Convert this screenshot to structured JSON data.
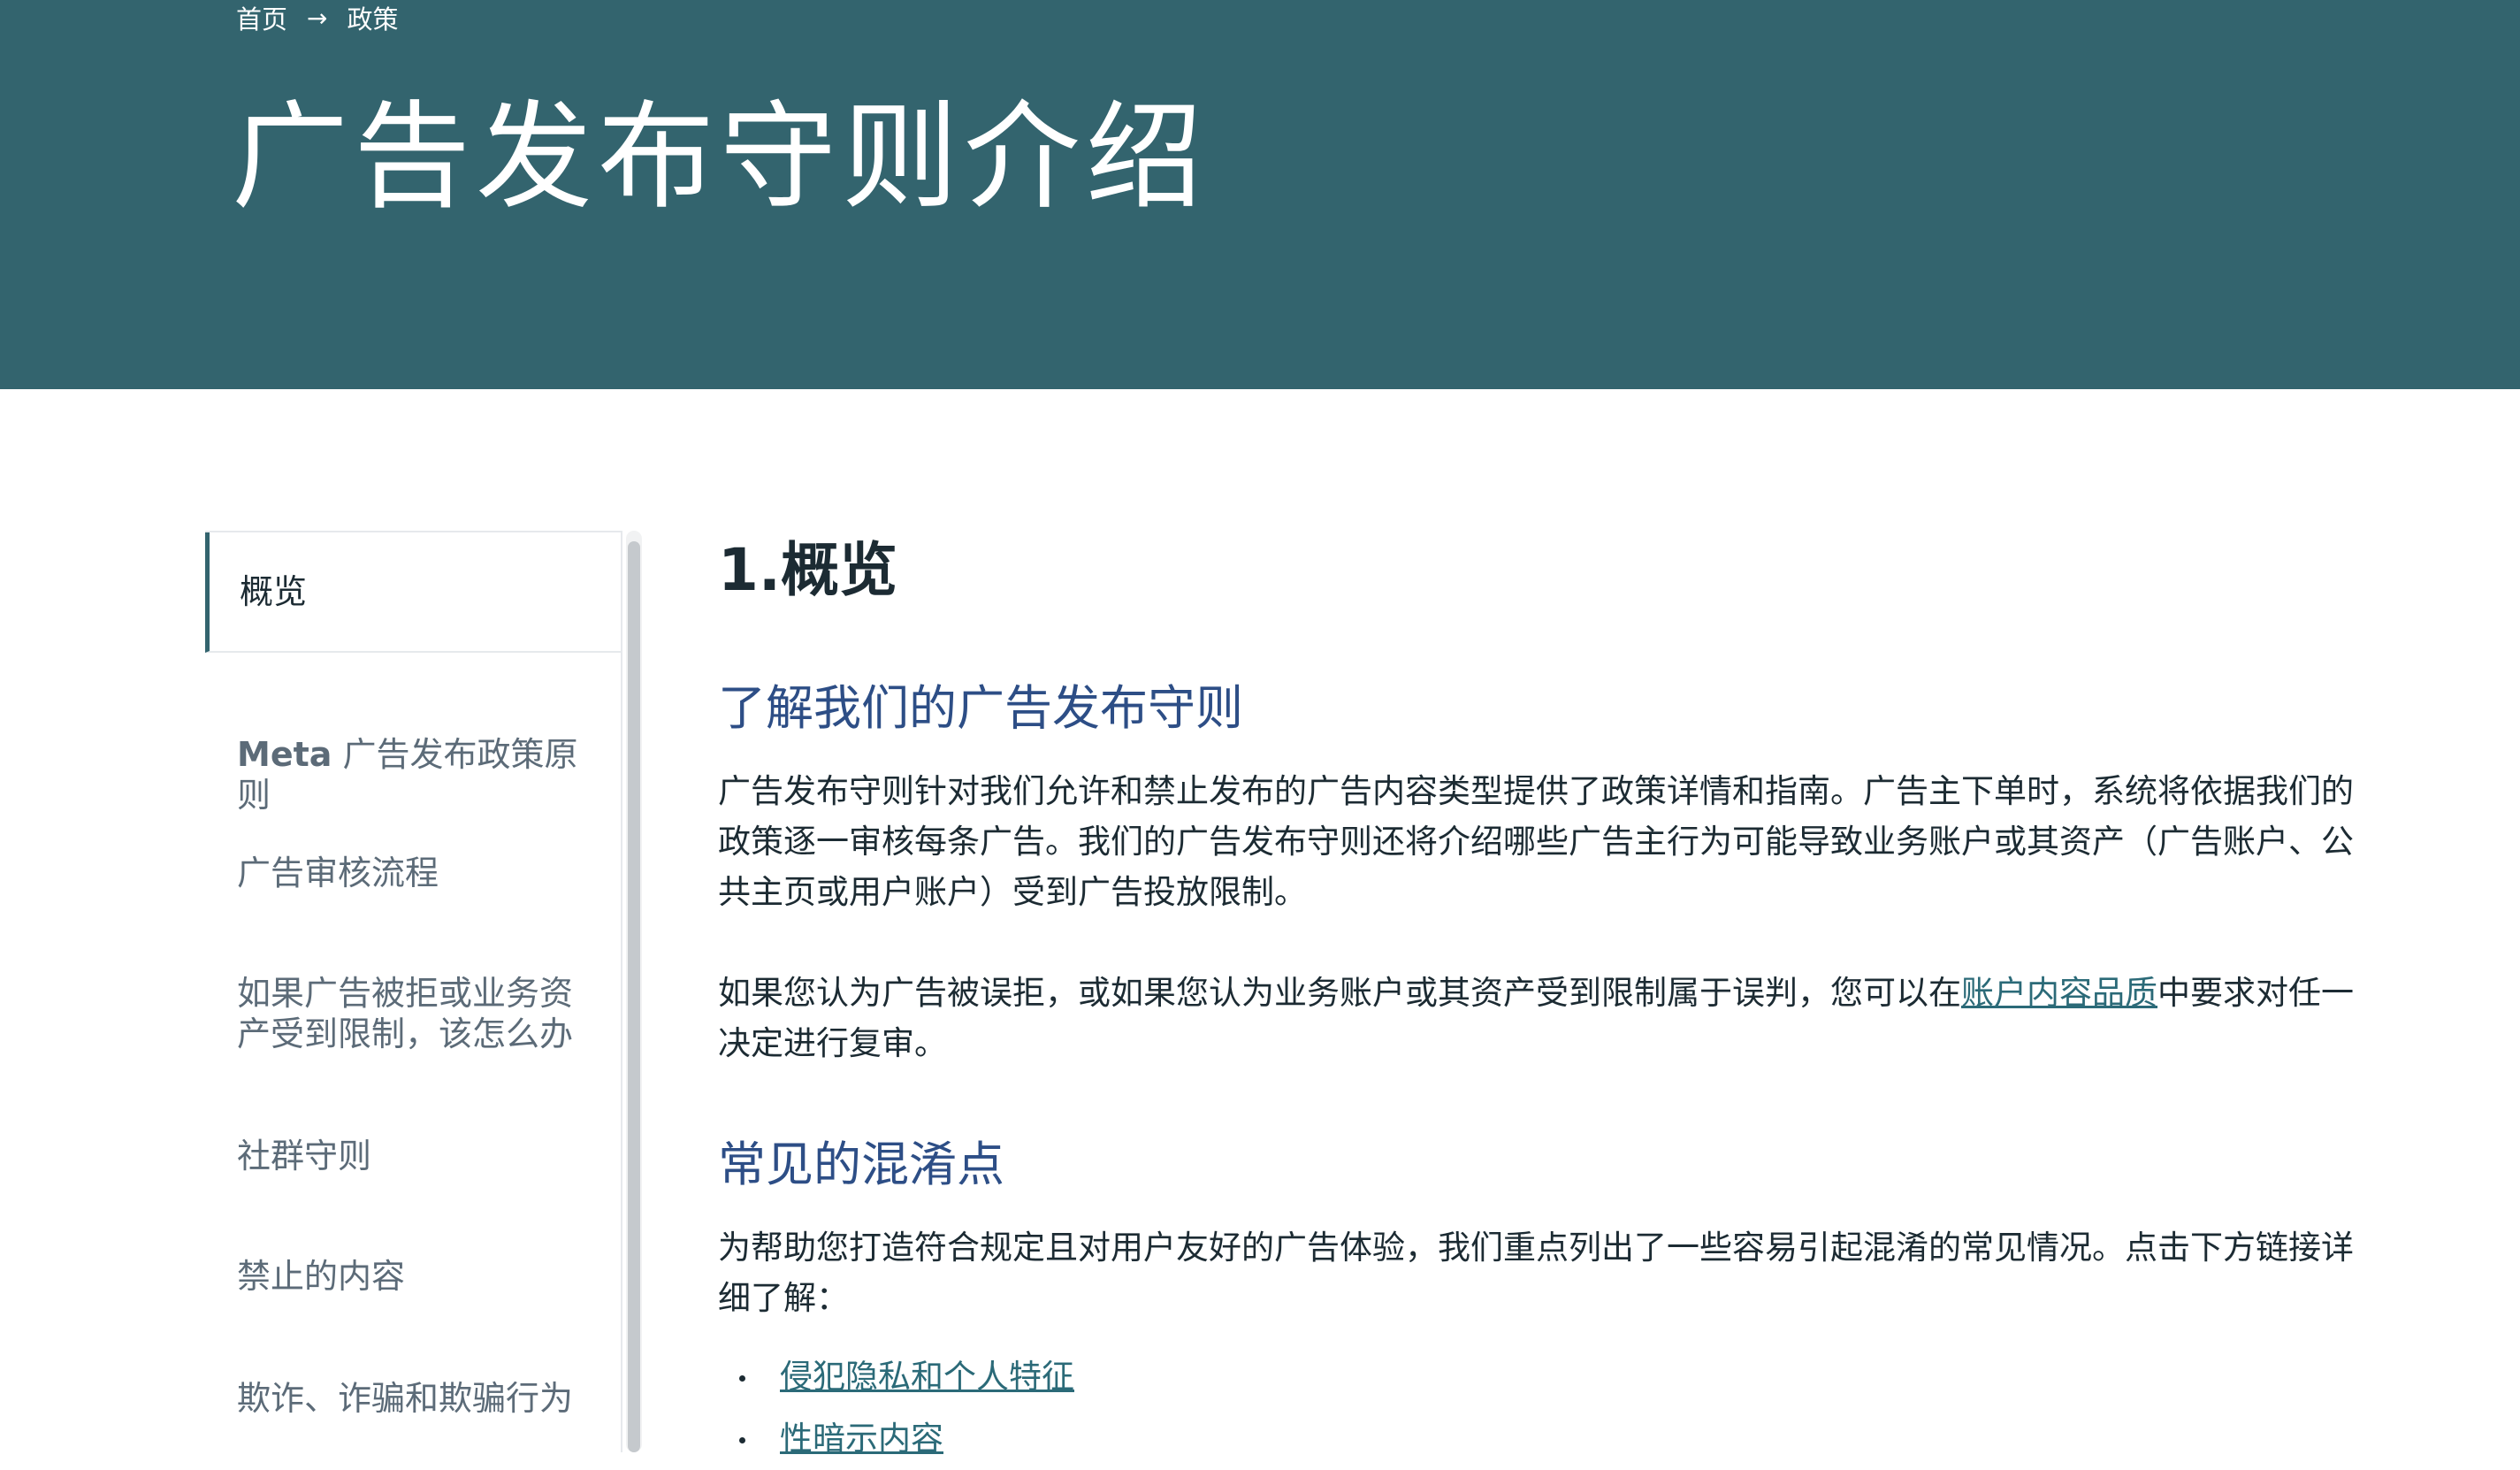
{
  "breadcrumb": {
    "home": "首页",
    "separator": "→",
    "current": "政策"
  },
  "hero": {
    "title": "广告发布守则介绍"
  },
  "sidebar": {
    "items": [
      {
        "label": "概览",
        "active": true
      },
      {
        "brand": "Meta",
        "label": " 广告发布政策原则"
      },
      {
        "label": "广告审核流程"
      },
      {
        "label": "如果广告被拒或业务资产受到限制，该怎么办"
      },
      {
        "label": "社群守则"
      },
      {
        "label": "禁止的内容"
      },
      {
        "label": "欺诈、诈骗和欺骗行为"
      }
    ]
  },
  "main": {
    "section_title": "1.概览",
    "intro_heading": "了解我们的广告发布守则",
    "intro_paragraph": "广告发布守则针对我们允许和禁止发布的广告内容类型提供了政策详情和指南。广告主下单时，系统将依据我们的政策逐一审核每条广告。我们的广告发布守则还将介绍哪些广告主行为可能导致业务账户或其资产（广告账户、公共主页或用户账户）受到广告投放限制。",
    "appeal_paragraph": {
      "before": "如果您认为广告被误拒，或如果您认为业务账户或其资产受到限制属于误判，您可以在",
      "link": "账户内容品质",
      "after": "中要求对任一决定进行复审。"
    },
    "confusion_heading": "常见的混淆点",
    "confusion_paragraph": "为帮助您打造符合规定且对用户友好的广告体验，我们重点列出了一些容易引起混淆的常见情况。点击下方链接详细了解：",
    "links": [
      "侵犯隐私和个人特征",
      "性暗示内容"
    ]
  },
  "colors": {
    "hero_bg": "#33646e",
    "heading_blue": "#2d4e86",
    "link_teal": "#2b6a78",
    "text_dark": "#1c2b33",
    "sidebar_text": "#5c6b78"
  }
}
